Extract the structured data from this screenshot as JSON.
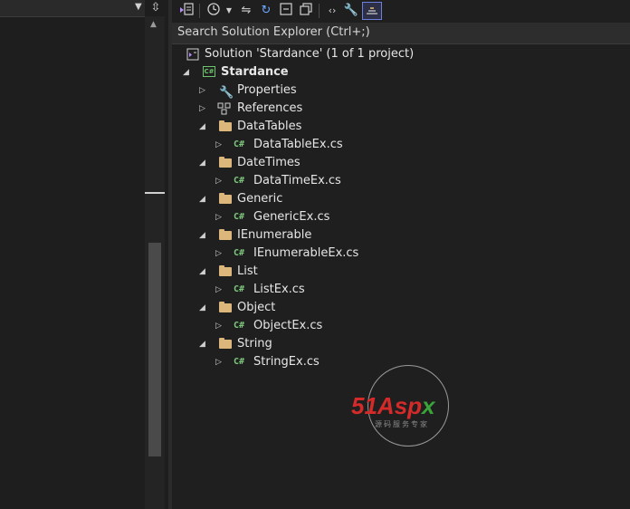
{
  "search": {
    "label": "Search Solution Explorer (Ctrl+;)"
  },
  "solution": {
    "label": "Solution 'Stardance' (1 of 1 project)"
  },
  "project": {
    "label": "Stardance",
    "icon_text": "C#"
  },
  "tree": [
    {
      "label": "Properties",
      "kind": "properties"
    },
    {
      "label": "References",
      "kind": "references"
    },
    {
      "label": "DataTables",
      "kind": "folder"
    },
    {
      "label": "DataTableEx.cs",
      "kind": "file"
    },
    {
      "label": "DateTimes",
      "kind": "folder"
    },
    {
      "label": "DataTimeEx.cs",
      "kind": "file"
    },
    {
      "label": "Generic",
      "kind": "folder"
    },
    {
      "label": "GenericEx.cs",
      "kind": "file"
    },
    {
      "label": "IEnumerable",
      "kind": "folder"
    },
    {
      "label": "IEnumerableEx.cs",
      "kind": "file"
    },
    {
      "label": "List",
      "kind": "folder"
    },
    {
      "label": "ListEx.cs",
      "kind": "file"
    },
    {
      "label": "Object",
      "kind": "folder"
    },
    {
      "label": "ObjectEx.cs",
      "kind": "file"
    },
    {
      "label": "String",
      "kind": "folder"
    },
    {
      "label": "StringEx.cs",
      "kind": "file"
    }
  ],
  "file_icon_text": "C#",
  "watermark": {
    "main_a": "51",
    "main_b": "Asp",
    "main_c": "x",
    "sub": "源码服务专家"
  },
  "colors": {
    "folder": "#dcb67a",
    "csharp": "#7ec87e",
    "accent": "#6d7fd8",
    "watermark_red": "#d42a2a",
    "watermark_green": "#3aa33a"
  }
}
